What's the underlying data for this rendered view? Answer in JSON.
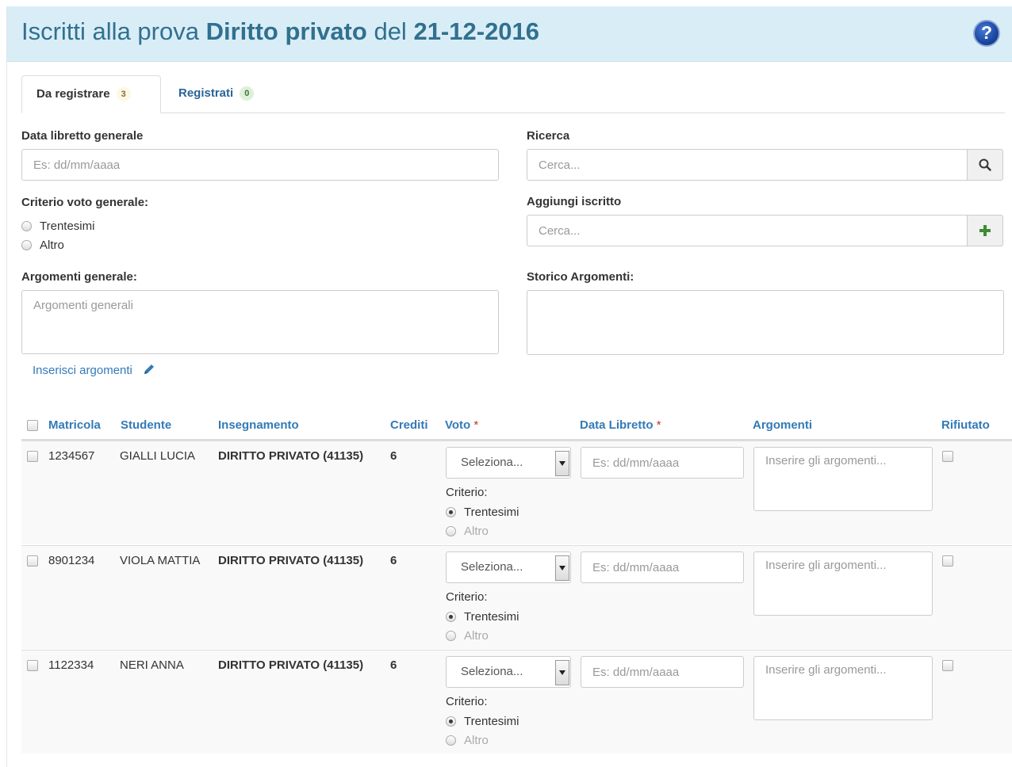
{
  "header": {
    "title_prefix": "Iscritti alla prova",
    "course": "Diritto privato",
    "title_mid": "del",
    "date": "21-12-2016",
    "help_icon": "question-circle-icon"
  },
  "tabs": [
    {
      "label": "Da registrare",
      "count": "3"
    },
    {
      "label": "Registrati",
      "count": "0"
    }
  ],
  "form": {
    "data_libretto": {
      "label": "Data libretto generale",
      "placeholder": "Es: dd/mm/aaaa"
    },
    "ricerca": {
      "label": "Ricerca",
      "placeholder": "Cerca...",
      "icon": "search-icon"
    },
    "criterio": {
      "label": "Criterio voto generale:",
      "options": [
        "Trentesimi",
        "Altro"
      ]
    },
    "aggiungi": {
      "label": "Aggiungi iscritto",
      "placeholder": "Cerca...",
      "icon": "plus-icon"
    },
    "argomenti": {
      "label": "Argomenti generale:",
      "placeholder": "Argomenti generali"
    },
    "storico": {
      "label": "Storico Argomenti:"
    },
    "inserisci_link": "Inserisci argomenti"
  },
  "table": {
    "columns": {
      "matricola": "Matricola",
      "studente": "Studente",
      "insegnamento": "Insegnamento",
      "crediti": "Crediti",
      "voto": "Voto",
      "data_libretto": "Data Libretto",
      "argomenti": "Argomenti",
      "rifiutato": "Rifiutato",
      "required_mark": "*"
    },
    "rows": [
      {
        "matricola": "1234567",
        "studente": "GIALLI LUCIA",
        "insegnamento": "DIRITTO PRIVATO (41135)",
        "crediti": "6"
      },
      {
        "matricola": "8901234",
        "studente": "VIOLA MATTIA",
        "insegnamento": "DIRITTO PRIVATO (41135)",
        "crediti": "6"
      },
      {
        "matricola": "1122334",
        "studente": "NERI ANNA",
        "insegnamento": "DIRITTO PRIVATO (41135)",
        "crediti": "6"
      }
    ],
    "row_controls": {
      "select_placeholder": "Seleziona...",
      "criterio_label": "Criterio:",
      "criterio_options": [
        "Trentesimi",
        "Altro"
      ],
      "selected_criterio": "Trentesimi",
      "date_placeholder": "Es: dd/mm/aaaa",
      "argomenti_placeholder": "Inserire gli argomenti..."
    }
  },
  "colors": {
    "header_bg": "#d9edf7",
    "title": "#31708f",
    "link": "#337ab7",
    "required": "#c9302c",
    "plus": "#3c8d2f"
  }
}
